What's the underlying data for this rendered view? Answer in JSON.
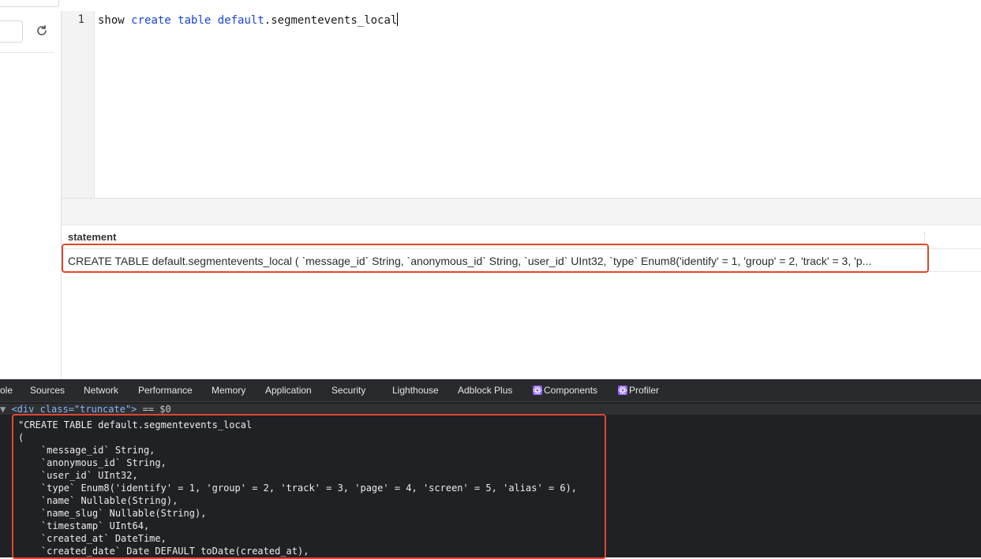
{
  "editor": {
    "line_number": "1",
    "tokens": [
      "show ",
      "create",
      " ",
      "table",
      " ",
      "default",
      ".segmentevents_local"
    ]
  },
  "results": {
    "column_header": "statement",
    "row_value": "CREATE TABLE default.segmentevents_local ( `message_id` String, `anonymous_id` String, `user_id` UInt32, `type` Enum8('identify' = 1, 'group' = 2, 'track' = 3, 'p..."
  },
  "devtools": {
    "tabs": [
      {
        "label": "ole"
      },
      {
        "label": "Sources"
      },
      {
        "label": "Network"
      },
      {
        "label": "Performance"
      },
      {
        "label": "Memory"
      },
      {
        "label": "Application"
      },
      {
        "label": "Security"
      },
      {
        "label": "Lighthouse"
      },
      {
        "label": "Adblock Plus"
      },
      {
        "label": "Components"
      },
      {
        "label": "Profiler"
      }
    ],
    "selected_node": "<div class=\"truncate\">",
    "selected_node_suffix": " == $0",
    "code_lines": [
      "\"CREATE TABLE default.segmentevents_local",
      "(",
      "    `message_id` String,",
      "    `anonymous_id` String,",
      "    `user_id` UInt32,",
      "    `type` Enum8('identify' = 1, 'group' = 2, 'track' = 3, 'page' = 4, 'screen' = 5, 'alias' = 6),",
      "    `name` Nullable(String),",
      "    `name_slug` Nullable(String),",
      "    `timestamp` UInt64,",
      "    `created_at` DateTime,",
      "    `created_date` Date DEFAULT toDate(created_at),"
    ]
  },
  "colors": {
    "keyword": "#1a44d6",
    "highlight_border": "#e0462e",
    "devtools_bg": "#202124"
  },
  "icons": [
    "refresh-icon",
    "react-components-icon",
    "react-profiler-icon",
    "node-expand-arrow-icon"
  ]
}
